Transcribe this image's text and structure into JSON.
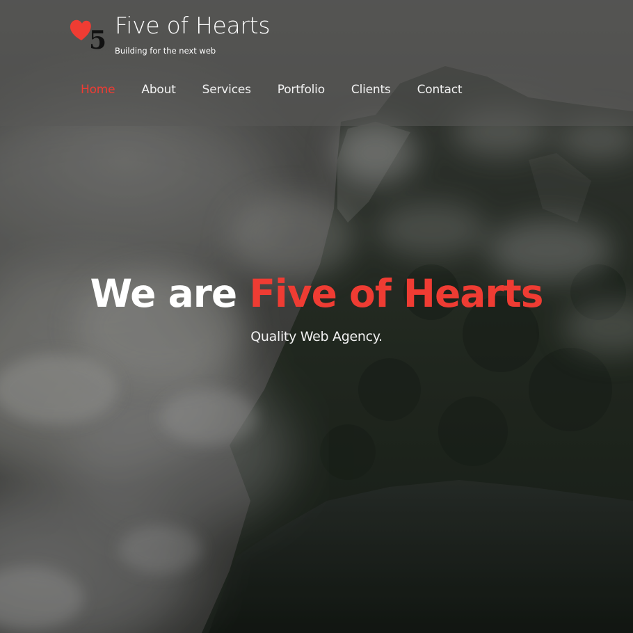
{
  "header": {
    "logo": {
      "icon": "heart-five-logo",
      "accent_color": "#ef3c33",
      "numeral": "5"
    },
    "title": "Five of Hearts",
    "tagline": "Building for the next web"
  },
  "nav": {
    "items": [
      {
        "label": "Home",
        "active": true
      },
      {
        "label": "About",
        "active": false
      },
      {
        "label": "Services",
        "active": false
      },
      {
        "label": "Portfolio",
        "active": false
      },
      {
        "label": "Clients",
        "active": false
      },
      {
        "label": "Contact",
        "active": false
      }
    ]
  },
  "hero": {
    "heading_prefix": "We are ",
    "heading_accent": "Five of Hearts",
    "subheading": "Quality Web Agency.",
    "background": "misty-forest-mountain-image"
  },
  "colors": {
    "accent": "#ef3c33",
    "text": "#ffffff",
    "header_overlay": "rgba(88,88,86,0.55)"
  }
}
